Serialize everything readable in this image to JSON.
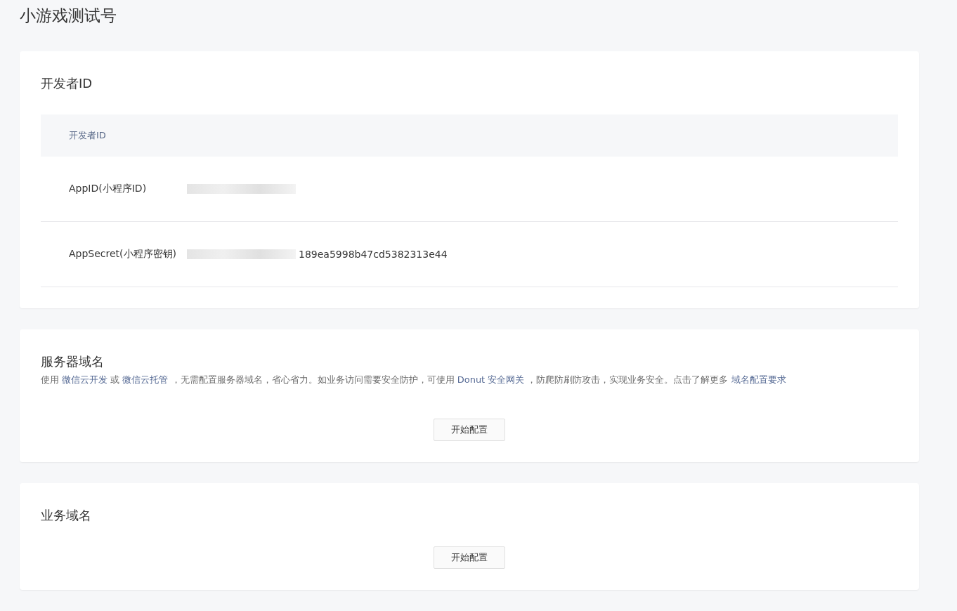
{
  "page_title": "小游戏测试号",
  "developer_card": {
    "title": "开发者ID",
    "table_header": "开发者ID",
    "rows": [
      {
        "label": "AppID(小程序ID)",
        "value": "",
        "redacted": true
      },
      {
        "label": "AppSecret(小程序密钥)",
        "value": "189ea5998b47cd5382313e44",
        "redacted": true
      }
    ]
  },
  "server_domain_card": {
    "title": "服务器域名",
    "description": [
      {
        "kind": "text",
        "text": "使用 "
      },
      {
        "kind": "link",
        "text": "微信云开发"
      },
      {
        "kind": "text",
        "text": " 或 "
      },
      {
        "kind": "link",
        "text": "微信云托管"
      },
      {
        "kind": "text",
        "text": " ，无需配置服务器域名，省心省力。如业务访问需要安全防护，可使用 "
      },
      {
        "kind": "link",
        "text": "Donut 安全网关"
      },
      {
        "kind": "text",
        "text": " ，防爬防刷防攻击，实现业务安全。点击了解更多 "
      },
      {
        "kind": "link",
        "text": "域名配置要求"
      }
    ],
    "button": "开始配置"
  },
  "business_domain_card": {
    "title": "业务域名",
    "button": "开始配置"
  }
}
